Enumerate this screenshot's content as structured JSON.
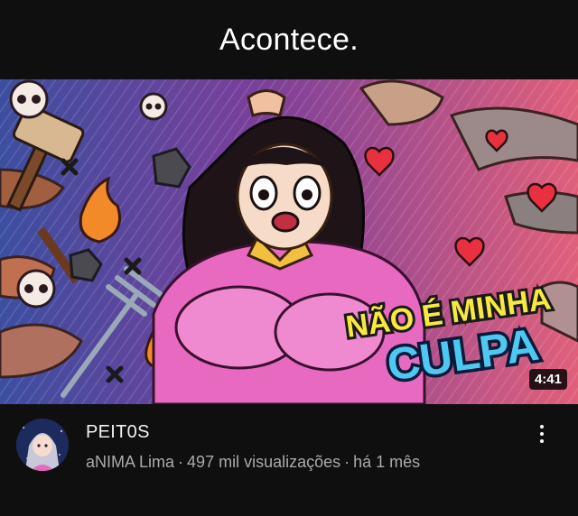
{
  "caption": {
    "text": "Acontece."
  },
  "video": {
    "thumbnail_text_line1": "NÃO É MINHA",
    "thumbnail_text_line2": "CULPA",
    "duration": "4:41",
    "title": "PEIT0S",
    "channel": "aNIMA Lima",
    "views": "497 mil visualizações",
    "age": "há 1 mês",
    "separator": "·"
  },
  "icons": {
    "menu": "more-vertical-icon",
    "avatar": "channel-avatar"
  },
  "colors": {
    "background": "#0f0f0f",
    "secondary_text": "#aaaaaa",
    "sweater": "#e86ac0",
    "title_yellow": "#f7e940",
    "title_blue": "#4ec8f0"
  }
}
